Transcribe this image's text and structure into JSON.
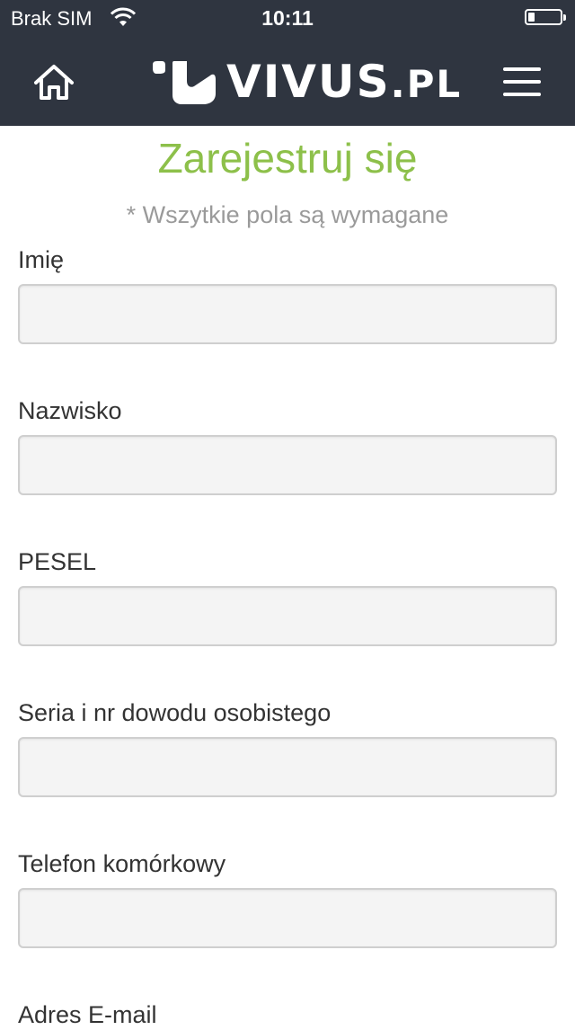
{
  "status_bar": {
    "carrier": "Brak SIM",
    "time": "10:11",
    "battery_level": 0.2
  },
  "nav": {
    "logo_text": "VIVUS",
    "logo_tld": ".PL",
    "home_icon": "home-icon",
    "menu_icon": "hamburger-menu-icon"
  },
  "form": {
    "title": "Zarejestruj się",
    "subtitle": "* Wszytkie pola są wymagane",
    "fields": [
      {
        "label": "Imię",
        "value": ""
      },
      {
        "label": "Nazwisko",
        "value": ""
      },
      {
        "label": "PESEL",
        "value": ""
      },
      {
        "label": "Seria i nr dowodu osobistego",
        "value": ""
      },
      {
        "label": "Telefon komórkowy",
        "value": ""
      },
      {
        "label": "Adres E-mail",
        "value": ""
      }
    ]
  },
  "colors": {
    "header_bg": "#2f3540",
    "accent_green": "#8dc04a",
    "subtitle_gray": "#9a9a9a",
    "input_bg": "#f4f4f4"
  }
}
